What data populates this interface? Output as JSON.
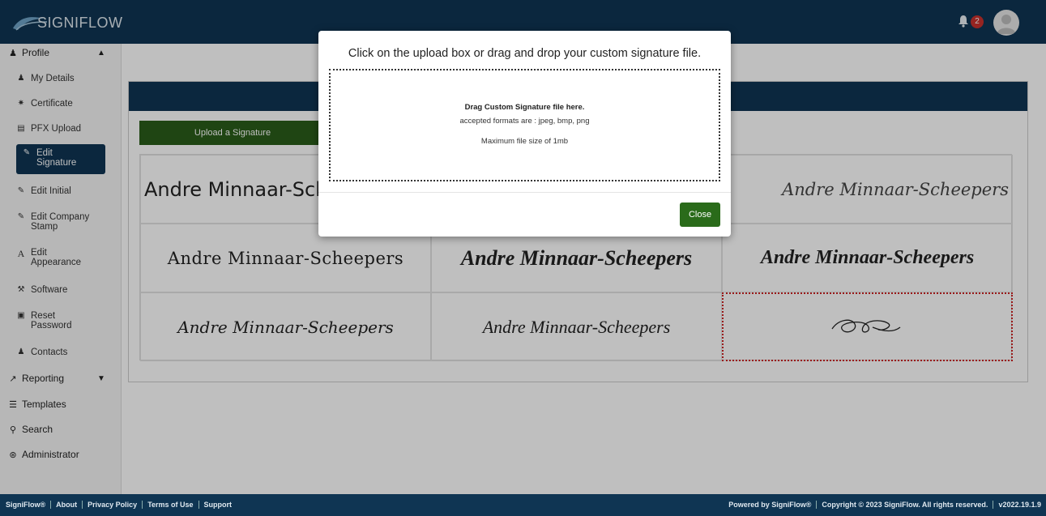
{
  "header": {
    "logo_text": "SIGNIFLOW",
    "notification_count": "2"
  },
  "sidebar": {
    "profile": "Profile",
    "items": [
      {
        "label": "My Details",
        "icon": "user-icon"
      },
      {
        "label": "Certificate",
        "icon": "certificate-icon"
      },
      {
        "label": "PFX Upload",
        "icon": "file-icon"
      },
      {
        "label": "Edit Signature",
        "icon": "edit-icon",
        "active": true
      },
      {
        "label": "Edit Initial",
        "icon": "edit-icon"
      },
      {
        "label": "Edit Company Stamp",
        "icon": "edit-icon"
      },
      {
        "label": "Edit Appearance",
        "icon": "font-icon"
      },
      {
        "label": "Software",
        "icon": "wrench-icon"
      },
      {
        "label": "Reset Password",
        "icon": "lock-icon"
      },
      {
        "label": "Contacts",
        "icon": "users-icon"
      }
    ],
    "reporting": "Reporting",
    "templates": "Templates",
    "search": "Search",
    "administrator": "Administrator"
  },
  "main": {
    "upload_button": "Upload a Signature",
    "signatures": [
      "Andre Minnaar-Scheepers",
      "Andre Minnaar-Scheepers",
      "Andre Minnaar-Scheepers",
      "Andre Minnaar-Scheepers",
      "Andre Minnaar-Scheepers",
      "Andre Minnaar-Scheepers",
      "Andre Minnaar-Scheepers",
      "Andre Minnaar-Scheepers"
    ]
  },
  "modal": {
    "title": "Click on the upload box or drag and drop your custom signature file.",
    "drop_main": "Drag Custom Signature file here.",
    "drop_formats": "accepted formats are : jpeg, bmp, png",
    "drop_size": "Maximum file size of 1mb",
    "close_label": "Close"
  },
  "footer": {
    "links": [
      "SigniFlow®",
      "About",
      "Privacy Policy",
      "Terms of Use",
      "Support"
    ],
    "powered_by": "Powered by SigniFlow®",
    "copyright": "Copyright © 2023 SigniFlow. All rights reserved.",
    "version": "v2022.19.1.9"
  },
  "colors": {
    "navy": "#0f3553",
    "green": "#2a6b1a",
    "selected_border": "#cc2222",
    "badge": "#c9302c"
  }
}
